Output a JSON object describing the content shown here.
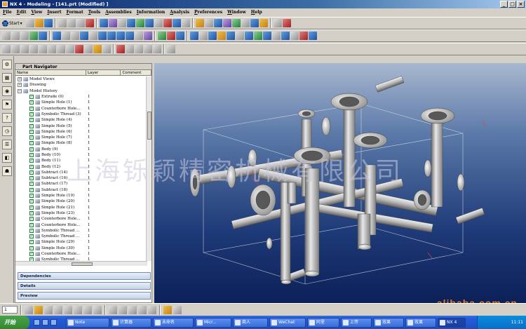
{
  "window": {
    "title": "NX 4 - Modeling - [141.prt (Modified) ]"
  },
  "menu": [
    {
      "first": "F",
      "rest": "ile"
    },
    {
      "first": "E",
      "rest": "dit"
    },
    {
      "first": "V",
      "rest": "iew"
    },
    {
      "first": "I",
      "rest": "nsert"
    },
    {
      "first": "F",
      "rest": "ormat"
    },
    {
      "first": "T",
      "rest": "ools"
    },
    {
      "first": "A",
      "rest": "ssemblies"
    },
    {
      "first": "I",
      "rest": "nformation"
    },
    {
      "first": "A",
      "rest": "nalysis"
    },
    {
      "first": "P",
      "rest": "references"
    },
    {
      "first": "W",
      "rest": "indow"
    },
    {
      "first": "H",
      "rest": "elp"
    }
  ],
  "toolbar": {
    "start_label": "Start"
  },
  "navigator": {
    "title": "Part Navigator",
    "columns": {
      "name": "Name",
      "layer": "Layer",
      "comment": "Comment"
    },
    "tree": [
      {
        "name": "Model Views",
        "layer": "",
        "type": "group"
      },
      {
        "name": "Drawing",
        "layer": "",
        "type": "group"
      },
      {
        "name": "Model History",
        "layer": "",
        "type": "group"
      },
      {
        "name": "Extrude (0)",
        "layer": "1",
        "type": "feature"
      },
      {
        "name": "Simple Hole (1)",
        "layer": "1",
        "type": "feature"
      },
      {
        "name": "Counterbore Hole...",
        "layer": "1",
        "type": "feature"
      },
      {
        "name": "Symbolic Thread (3)",
        "layer": "1",
        "type": "feature"
      },
      {
        "name": "Simple Hole (4)",
        "layer": "1",
        "type": "feature"
      },
      {
        "name": "Simple Hole (5)",
        "layer": "1",
        "type": "feature"
      },
      {
        "name": "Simple Hole (6)",
        "layer": "1",
        "type": "feature"
      },
      {
        "name": "Simple Hole (7)",
        "layer": "1",
        "type": "feature"
      },
      {
        "name": "Simple Hole (8)",
        "layer": "1",
        "type": "feature"
      },
      {
        "name": "Body (9)",
        "layer": "1",
        "type": "feature"
      },
      {
        "name": "Body (10)",
        "layer": "1",
        "type": "feature"
      },
      {
        "name": "Body (11)",
        "layer": "1",
        "type": "feature"
      },
      {
        "name": "Body (12)",
        "layer": "1",
        "type": "feature"
      },
      {
        "name": "Subtract (14)",
        "layer": "1",
        "type": "feature"
      },
      {
        "name": "Subtract (16)",
        "layer": "1",
        "type": "feature"
      },
      {
        "name": "Subtract (17)",
        "layer": "1",
        "type": "feature"
      },
      {
        "name": "Subtract (18)",
        "layer": "1",
        "type": "feature"
      },
      {
        "name": "Simple Hole (19)",
        "layer": "1",
        "type": "feature"
      },
      {
        "name": "Simple Hole (20)",
        "layer": "1",
        "type": "feature"
      },
      {
        "name": "Simple Hole (21)",
        "layer": "1",
        "type": "feature"
      },
      {
        "name": "Simple Hole (23)",
        "layer": "1",
        "type": "feature"
      },
      {
        "name": "Counterbore Hole...",
        "layer": "1",
        "type": "feature"
      },
      {
        "name": "Counterbore Hole...",
        "layer": "1",
        "type": "feature"
      },
      {
        "name": "Symbolic Thread ...",
        "layer": "1",
        "type": "feature"
      },
      {
        "name": "Symbolic Thread ...",
        "layer": "1",
        "type": "feature"
      },
      {
        "name": "Simple Hole (29)",
        "layer": "1",
        "type": "feature"
      },
      {
        "name": "Simple Hole (30)",
        "layer": "1",
        "type": "feature"
      },
      {
        "name": "Counterbore Hole...",
        "layer": "1",
        "type": "feature"
      },
      {
        "name": "Symbolic Thread ...",
        "layer": "1",
        "type": "feature"
      }
    ],
    "panels": [
      "Dependencies",
      "Details",
      "Preview"
    ]
  },
  "watermark": "上海铄颖精密机械有限公司",
  "site_watermark": "alibaba.com.cn",
  "bottom": {
    "layer_value": "1"
  },
  "taskbar": {
    "start": "开始",
    "tasks": [
      "Note",
      "计算器",
      "未命名",
      "Micr...",
      "商人",
      "WeChat",
      "阿里",
      "上传",
      "效果",
      "效果",
      "NX 4"
    ],
    "time": "11:11"
  }
}
